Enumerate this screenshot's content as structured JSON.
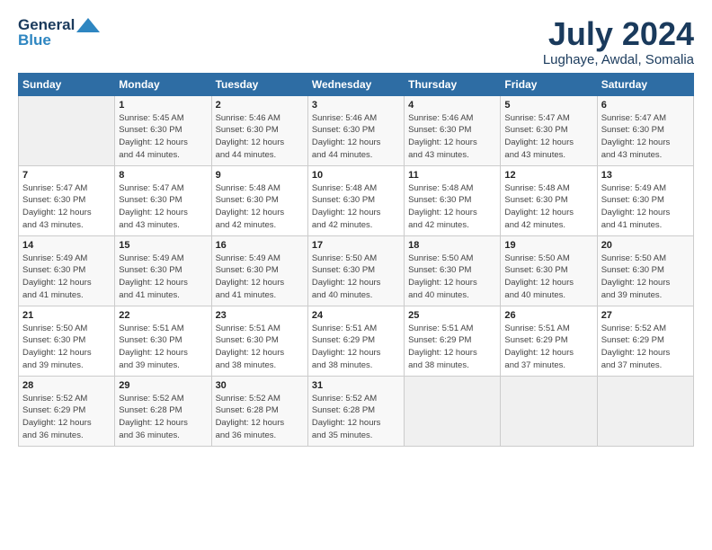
{
  "header": {
    "logo_line1": "General",
    "logo_line2": "Blue",
    "month_year": "July 2024",
    "location": "Lughaye, Awdal, Somalia"
  },
  "days_of_week": [
    "Sunday",
    "Monday",
    "Tuesday",
    "Wednesday",
    "Thursday",
    "Friday",
    "Saturday"
  ],
  "weeks": [
    [
      {
        "day": "",
        "info": ""
      },
      {
        "day": "1",
        "info": "Sunrise: 5:45 AM\nSunset: 6:30 PM\nDaylight: 12 hours\nand 44 minutes."
      },
      {
        "day": "2",
        "info": "Sunrise: 5:46 AM\nSunset: 6:30 PM\nDaylight: 12 hours\nand 44 minutes."
      },
      {
        "day": "3",
        "info": "Sunrise: 5:46 AM\nSunset: 6:30 PM\nDaylight: 12 hours\nand 44 minutes."
      },
      {
        "day": "4",
        "info": "Sunrise: 5:46 AM\nSunset: 6:30 PM\nDaylight: 12 hours\nand 43 minutes."
      },
      {
        "day": "5",
        "info": "Sunrise: 5:47 AM\nSunset: 6:30 PM\nDaylight: 12 hours\nand 43 minutes."
      },
      {
        "day": "6",
        "info": "Sunrise: 5:47 AM\nSunset: 6:30 PM\nDaylight: 12 hours\nand 43 minutes."
      }
    ],
    [
      {
        "day": "7",
        "info": "Sunrise: 5:47 AM\nSunset: 6:30 PM\nDaylight: 12 hours\nand 43 minutes."
      },
      {
        "day": "8",
        "info": "Sunrise: 5:47 AM\nSunset: 6:30 PM\nDaylight: 12 hours\nand 43 minutes."
      },
      {
        "day": "9",
        "info": "Sunrise: 5:48 AM\nSunset: 6:30 PM\nDaylight: 12 hours\nand 42 minutes."
      },
      {
        "day": "10",
        "info": "Sunrise: 5:48 AM\nSunset: 6:30 PM\nDaylight: 12 hours\nand 42 minutes."
      },
      {
        "day": "11",
        "info": "Sunrise: 5:48 AM\nSunset: 6:30 PM\nDaylight: 12 hours\nand 42 minutes."
      },
      {
        "day": "12",
        "info": "Sunrise: 5:48 AM\nSunset: 6:30 PM\nDaylight: 12 hours\nand 42 minutes."
      },
      {
        "day": "13",
        "info": "Sunrise: 5:49 AM\nSunset: 6:30 PM\nDaylight: 12 hours\nand 41 minutes."
      }
    ],
    [
      {
        "day": "14",
        "info": "Sunrise: 5:49 AM\nSunset: 6:30 PM\nDaylight: 12 hours\nand 41 minutes."
      },
      {
        "day": "15",
        "info": "Sunrise: 5:49 AM\nSunset: 6:30 PM\nDaylight: 12 hours\nand 41 minutes."
      },
      {
        "day": "16",
        "info": "Sunrise: 5:49 AM\nSunset: 6:30 PM\nDaylight: 12 hours\nand 41 minutes."
      },
      {
        "day": "17",
        "info": "Sunrise: 5:50 AM\nSunset: 6:30 PM\nDaylight: 12 hours\nand 40 minutes."
      },
      {
        "day": "18",
        "info": "Sunrise: 5:50 AM\nSunset: 6:30 PM\nDaylight: 12 hours\nand 40 minutes."
      },
      {
        "day": "19",
        "info": "Sunrise: 5:50 AM\nSunset: 6:30 PM\nDaylight: 12 hours\nand 40 minutes."
      },
      {
        "day": "20",
        "info": "Sunrise: 5:50 AM\nSunset: 6:30 PM\nDaylight: 12 hours\nand 39 minutes."
      }
    ],
    [
      {
        "day": "21",
        "info": "Sunrise: 5:50 AM\nSunset: 6:30 PM\nDaylight: 12 hours\nand 39 minutes."
      },
      {
        "day": "22",
        "info": "Sunrise: 5:51 AM\nSunset: 6:30 PM\nDaylight: 12 hours\nand 39 minutes."
      },
      {
        "day": "23",
        "info": "Sunrise: 5:51 AM\nSunset: 6:30 PM\nDaylight: 12 hours\nand 38 minutes."
      },
      {
        "day": "24",
        "info": "Sunrise: 5:51 AM\nSunset: 6:29 PM\nDaylight: 12 hours\nand 38 minutes."
      },
      {
        "day": "25",
        "info": "Sunrise: 5:51 AM\nSunset: 6:29 PM\nDaylight: 12 hours\nand 38 minutes."
      },
      {
        "day": "26",
        "info": "Sunrise: 5:51 AM\nSunset: 6:29 PM\nDaylight: 12 hours\nand 37 minutes."
      },
      {
        "day": "27",
        "info": "Sunrise: 5:52 AM\nSunset: 6:29 PM\nDaylight: 12 hours\nand 37 minutes."
      }
    ],
    [
      {
        "day": "28",
        "info": "Sunrise: 5:52 AM\nSunset: 6:29 PM\nDaylight: 12 hours\nand 36 minutes."
      },
      {
        "day": "29",
        "info": "Sunrise: 5:52 AM\nSunset: 6:28 PM\nDaylight: 12 hours\nand 36 minutes."
      },
      {
        "day": "30",
        "info": "Sunrise: 5:52 AM\nSunset: 6:28 PM\nDaylight: 12 hours\nand 36 minutes."
      },
      {
        "day": "31",
        "info": "Sunrise: 5:52 AM\nSunset: 6:28 PM\nDaylight: 12 hours\nand 35 minutes."
      },
      {
        "day": "",
        "info": ""
      },
      {
        "day": "",
        "info": ""
      },
      {
        "day": "",
        "info": ""
      }
    ]
  ]
}
